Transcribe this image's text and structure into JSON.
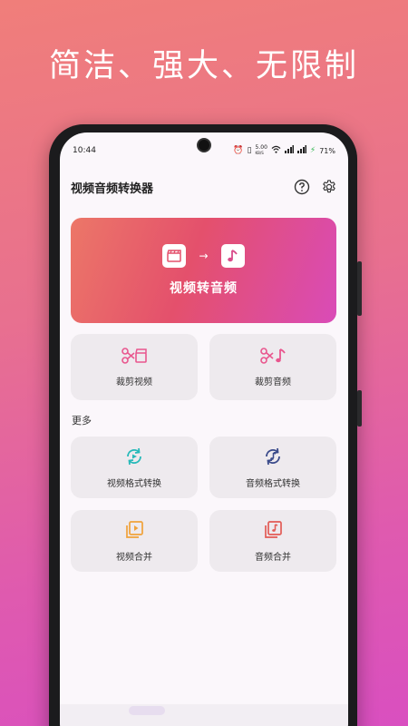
{
  "promo": {
    "headline": "简洁、强大、无限制"
  },
  "status_bar": {
    "time": "10:44",
    "speed_value": "5.00",
    "speed_unit": "KB/S",
    "battery": "71%"
  },
  "app": {
    "title": "视频音频转换器"
  },
  "hero": {
    "label": "视频转音频"
  },
  "tools": [
    {
      "label": "裁剪视频",
      "icon": "scissors-video-icon"
    },
    {
      "label": "裁剪音频",
      "icon": "scissors-music-icon"
    }
  ],
  "more": {
    "title": "更多",
    "items": [
      {
        "label": "视频格式转换",
        "icon": "video-convert-icon"
      },
      {
        "label": "音频格式转换",
        "icon": "audio-convert-icon"
      },
      {
        "label": "视频合并",
        "icon": "video-merge-icon"
      },
      {
        "label": "音频合并",
        "icon": "audio-merge-icon"
      }
    ]
  },
  "colors": {
    "accent_pink": "#e9568e",
    "accent_teal": "#27b9b9",
    "accent_navy": "#3a4a8a",
    "accent_orange": "#f0a23a",
    "accent_red": "#e25b55"
  }
}
